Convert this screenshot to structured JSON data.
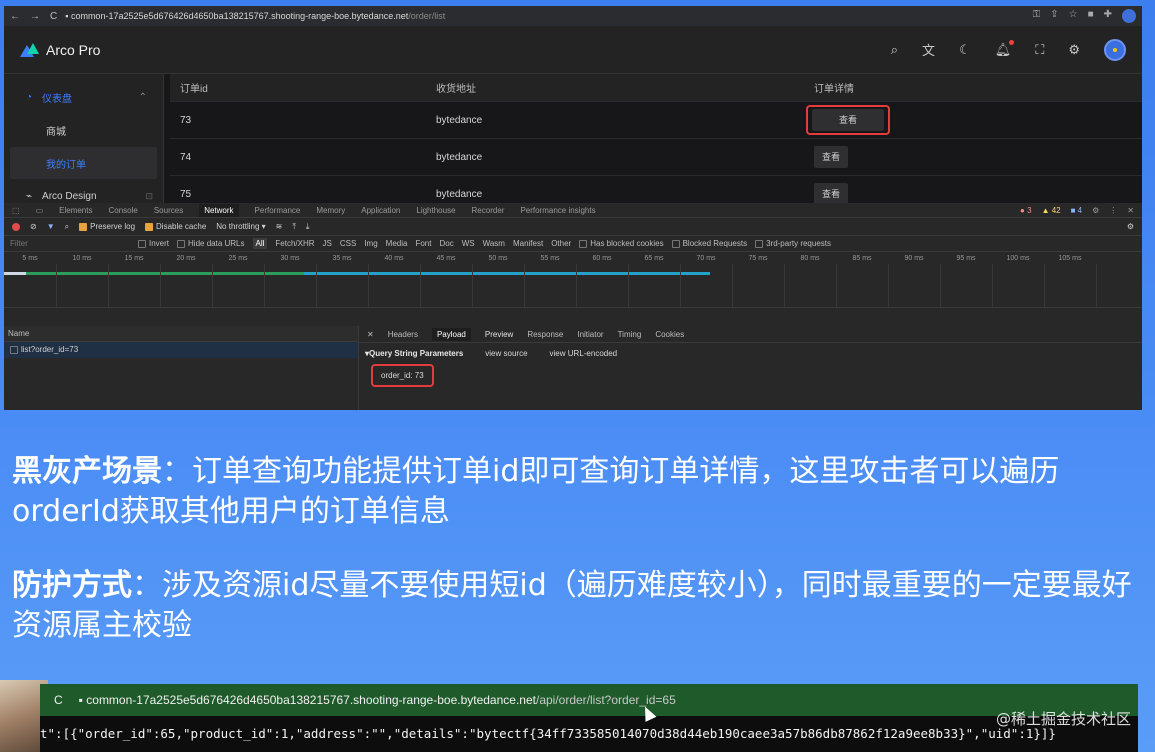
{
  "browser": {
    "url_host": "common-17a2525e5d676426d4650ba138215767.shooting-range-boe.bytedance.net",
    "url_path": "/order/list"
  },
  "app": {
    "brand": "Arco Pro",
    "sidebar": [
      {
        "label": "仪表盘",
        "expanded": true
      },
      {
        "label": "商城"
      },
      {
        "label": "我的订单",
        "active": true
      },
      {
        "label": "Arco Design"
      }
    ],
    "table": {
      "headers": [
        "订单id",
        "收货地址",
        "订单详情"
      ],
      "rows": [
        {
          "id": "73",
          "address": "bytedance",
          "action": "查看"
        },
        {
          "id": "74",
          "address": "bytedance",
          "action": "查看"
        },
        {
          "id": "75",
          "address": "bytedance",
          "action": "查看"
        }
      ]
    }
  },
  "devtools": {
    "tabs": [
      "Elements",
      "Console",
      "Sources",
      "Network",
      "Performance",
      "Memory",
      "Application",
      "Lighthouse",
      "Recorder",
      "Performance insights"
    ],
    "selected_tab": "Network",
    "counts": {
      "errors": "3",
      "warnings": "42",
      "info": "4"
    },
    "toolbar": {
      "preserve_log": "Preserve log",
      "disable_cache": "Disable cache",
      "throttle": "No throttling"
    },
    "filter": {
      "placeholder": "Filter",
      "options": [
        "Invert",
        "Hide data URLs",
        "All",
        "Fetch/XHR",
        "JS",
        "CSS",
        "Img",
        "Media",
        "Font",
        "Doc",
        "WS",
        "Wasm",
        "Manifest",
        "Other",
        "Has blocked cookies",
        "Blocked Requests",
        "3rd-party requests"
      ]
    },
    "ticks": [
      "5 ms",
      "10 ms",
      "15 ms",
      "20 ms",
      "25 ms",
      "30 ms",
      "35 ms",
      "40 ms",
      "45 ms",
      "50 ms",
      "55 ms",
      "60 ms",
      "65 ms",
      "70 ms",
      "75 ms",
      "80 ms",
      "85 ms",
      "90 ms",
      "95 ms",
      "100 ms",
      "105 ms"
    ],
    "names_header": "Name",
    "request": "list?order_id=73",
    "detail_tabs": [
      "Headers",
      "Payload",
      "Preview",
      "Response",
      "Initiator",
      "Timing",
      "Cookies"
    ],
    "selected_detail_tab": "Payload",
    "qsp_title": "▾Query String Parameters",
    "view_source": "view source",
    "view_url_encoded": "view URL-encoded",
    "param": "order_id: 73"
  },
  "slide": {
    "p1_bold": "黑灰产场景",
    "p1_text": "：订单查询功能提供订单id即可查询订单详情，这里攻击者可以遍历orderId获取其他用户的订单信息",
    "p2_bold": "防护方式",
    "p2_text": "：涉及资源id尽量不要使用短id（遍历难度较小），同时最重要的一定要最好资源属主校验"
  },
  "bottom_shot": {
    "url_host": "common-17a2525e5d676426d4650ba138215767.shooting-range-boe.bytedance.net",
    "url_path": "/api/order/list?order_id=65",
    "response": "t\":[{\"order_id\":65,\"product_id\":1,\"address\":\"\",\"details\":\"bytectf{34ff733585014070d38d44eb190caee3a57b86db87862f12a9ee8b33}\",\"uid\":1}]}"
  },
  "watermark": "@稀土掘金技术社区"
}
